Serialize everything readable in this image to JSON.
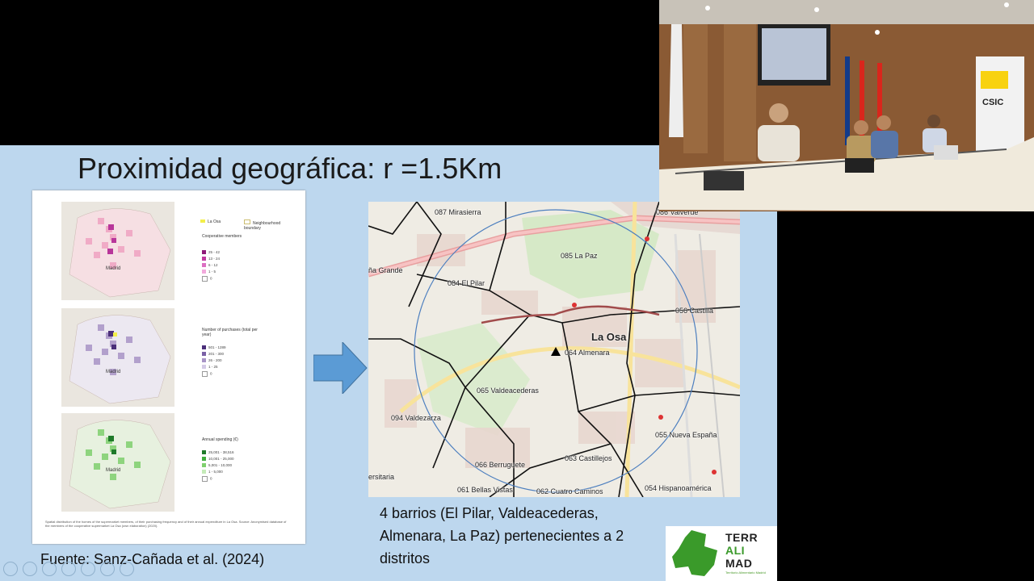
{
  "slide": {
    "title": "Proximidad geográfica: r =1.5Km",
    "source": "Fuente: Sanz-Cañada et al. (2024)",
    "bottom_text": "4 barrios (El Pilar, Valdeacederas, Almenara, La Paz) pertenecientes a 2 distritos"
  },
  "figure": {
    "header_legend": [
      "La Osa",
      "Neighbourhood boundary"
    ],
    "panels": [
      {
        "legend_title": "Cooperative members",
        "items": [
          "25 - 42",
          "13 - 24",
          "6 - 12",
          "1 - 5",
          "0"
        ],
        "colors": [
          "#8e1a78",
          "#c0399f",
          "#dc6fc2",
          "#f2a9dc",
          "#ffffff"
        ],
        "map_label": "Madrid"
      },
      {
        "legend_title": "Number of purchases (total per year)",
        "items": [
          "501 - 1289",
          "201 - 300",
          "26 - 200",
          "1 - 25",
          "0"
        ],
        "colors": [
          "#4b2f7a",
          "#7a61a6",
          "#a894c6",
          "#d4cae6",
          "#ffffff"
        ],
        "map_label": "Madrid"
      },
      {
        "legend_title": "Annual spending (€)",
        "items": [
          "25,001 - 38,516",
          "10,001 - 25,000",
          "5,001 - 10,000",
          "1 - 5,000",
          "0"
        ],
        "colors": [
          "#1f7a2a",
          "#3fae3c",
          "#7fd06e",
          "#c5ebb9",
          "#ffffff"
        ],
        "map_label": "Madrid"
      }
    ],
    "caption": "Spatial distribution of the homes of the supermarket members, of their purchasing frequency and of their annual expenditure in La Osa. Source: Anonymised database of the members of the cooperative supermarket La Osa (own elaboration) (2020)."
  },
  "map": {
    "center_label": "La Osa",
    "labels": [
      "087 Mirasierra",
      "086 Valverde",
      "085 La Paz",
      "084 El Pilar",
      "ña Grande",
      "056 Castilla",
      "064 Almenara",
      "065 Valdeacederas",
      "094 Valdezarza",
      "055 Nueva España",
      "063 Castillejos",
      "066 Berruguete",
      "ersitaria",
      "061 Bellas Vistas",
      "062 Cuatro Caminos",
      "054 Hispanoamérica"
    ]
  },
  "logo": {
    "line1": "TERR",
    "line2": "ALI",
    "line3": "MAD",
    "sub": "Territorio Alimentario Madrid"
  },
  "video": {
    "sign_text": "CSIC"
  }
}
